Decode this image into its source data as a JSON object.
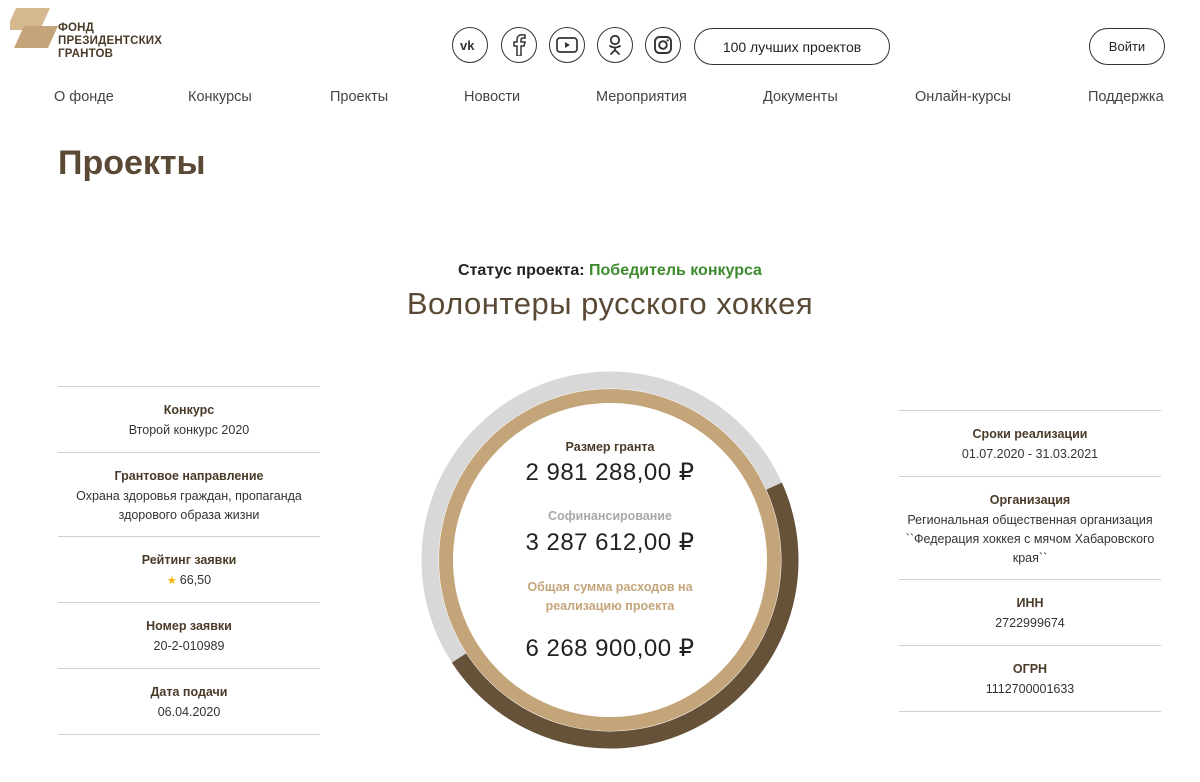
{
  "header": {
    "logo_lines": [
      "Фонд",
      "президентских",
      "грантов"
    ],
    "social_icons": [
      "vk-icon",
      "facebook-icon",
      "youtube-icon",
      "odnoklassniki-icon",
      "instagram-icon"
    ],
    "top_projects_label": "100 лучших проектов",
    "login_label": "Войти"
  },
  "nav": {
    "items": [
      "О фонде",
      "Конкурсы",
      "Проекты",
      "Новости",
      "Мероприятия",
      "Документы",
      "Онлайн-курсы",
      "Поддержка"
    ]
  },
  "page": {
    "title": "Проекты",
    "status_label": "Статус проекта:",
    "status_value": "Победитель конкурса",
    "project_title": "Волонтеры русского хоккея"
  },
  "left_info": [
    {
      "label": "Конкурс",
      "value": "Второй конкурс 2020"
    },
    {
      "label": "Грантовое направление",
      "value": "Охрана здоровья граждан, пропаганда здорового образа жизни"
    },
    {
      "label": "Рейтинг заявки",
      "value": "66,50"
    },
    {
      "label": "Номер заявки",
      "value": "20-2-010989"
    },
    {
      "label": "Дата подачи",
      "value": "06.04.2020"
    }
  ],
  "right_info": [
    {
      "label": "Сроки реализации",
      "value": "01.07.2020 - 31.03.2021"
    },
    {
      "label": "Организация",
      "value": "Региональная общественная организация ``Федерация хоккея с мячом Хабаровского края``"
    },
    {
      "label": "ИНН",
      "value": "2722999674"
    },
    {
      "label": "ОГРН",
      "value": "1112700001633"
    }
  ],
  "finance": {
    "grant_label": "Размер гранта",
    "grant_amount": "2 981 288,00 ₽",
    "cofinancing_label": "Софинансирование",
    "cofinancing_amount": "3 287 612,00 ₽",
    "total_label": "Общая сумма расходов на реализацию проекта",
    "total_amount": "6 268 900,00 ₽",
    "grant_share": 0.4756,
    "colors": {
      "grant": "#c4a57a",
      "cofinancing": "#665238",
      "remainder": "#d8d8d8",
      "total_label": "#c4a57a",
      "cofinancing_label": "#a9a9a9",
      "status": "#3e8a2e"
    }
  }
}
